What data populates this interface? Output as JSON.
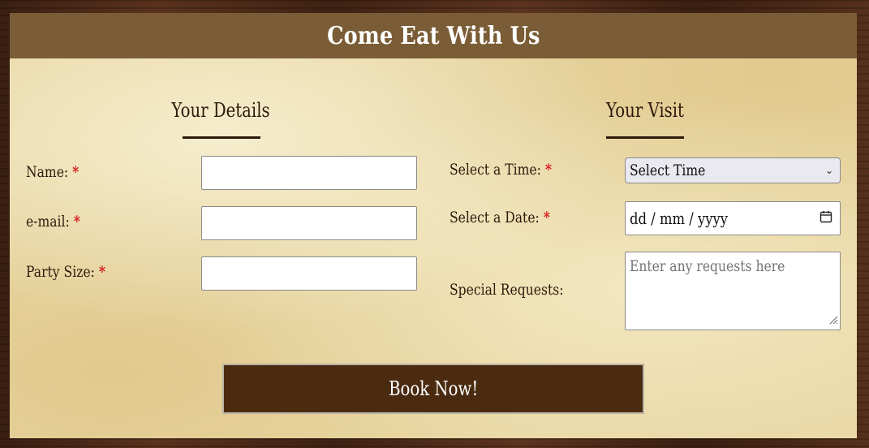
{
  "header": {
    "title": "Come Eat With Us"
  },
  "details": {
    "title": "Your Details",
    "fields": {
      "name": {
        "label": "Name:",
        "required": "*",
        "value": ""
      },
      "email": {
        "label": "e-mail:",
        "required": "*",
        "value": ""
      },
      "party": {
        "label": "Party Size:",
        "required": "*",
        "value": ""
      }
    }
  },
  "visit": {
    "title": "Your Visit",
    "time": {
      "label": "Select a Time:",
      "required": "*",
      "selected": "Select Time"
    },
    "date": {
      "label": "Select a Date:",
      "required": "*",
      "placeholder": "dd / mm / yyyy"
    },
    "requests": {
      "label": "Special Requests:",
      "placeholder": "Enter any requests here"
    }
  },
  "submit": {
    "label": "Book Now!"
  },
  "colors": {
    "header_bg": "#7a5d36",
    "button_bg": "#4a2b10",
    "required": "#d41b1b",
    "parchment": "#e9d7a3"
  },
  "icons": {
    "select": "chevron-down-icon",
    "date": "calendar-icon",
    "textarea": "resize-grip-icon"
  }
}
